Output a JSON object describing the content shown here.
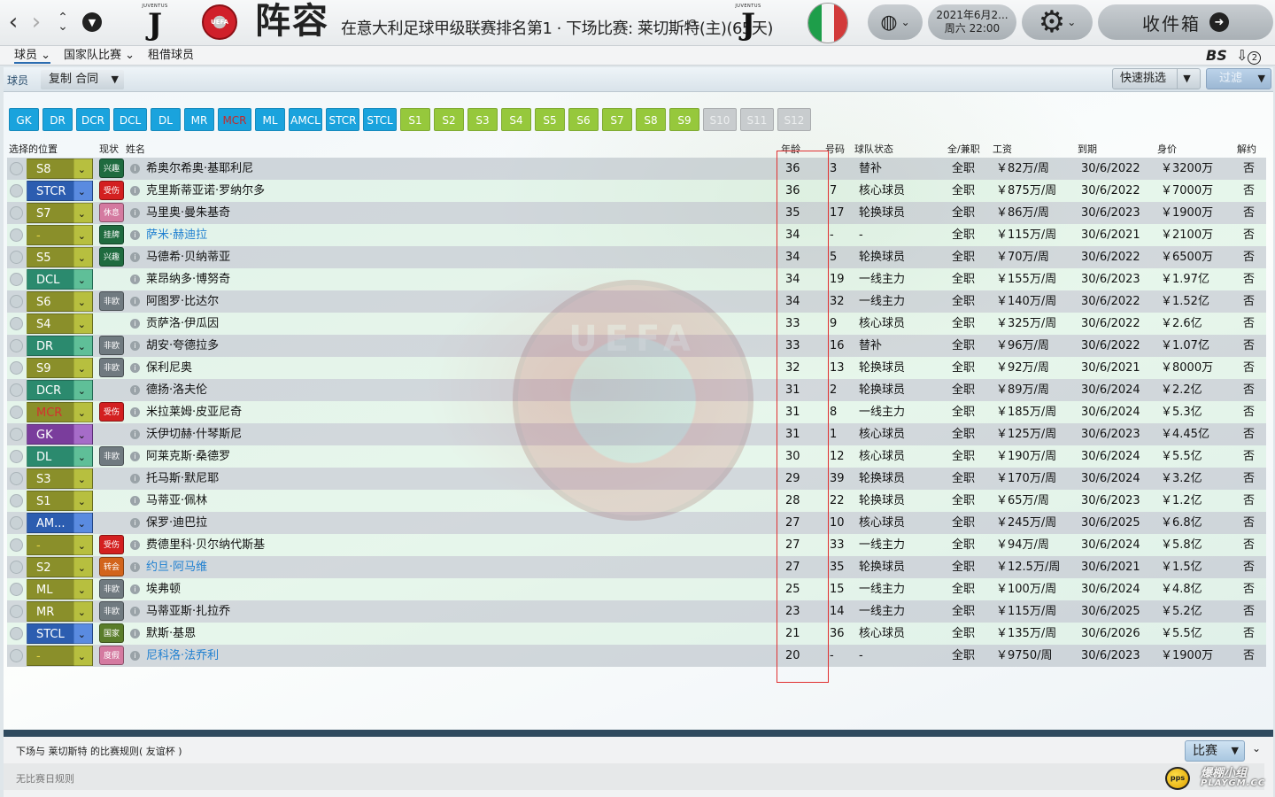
{
  "header": {
    "club_logo_text": "JUVENTUS",
    "club_logo_letter": "J",
    "uefa_text": "UEFA",
    "title": "阵容",
    "subtitle": "在意大利足球甲级联赛排名第1 · 下场比赛: 莱切斯特(主)(65天)",
    "date_line1": "2021年6月2...",
    "date_line2": "周六 22:00",
    "inbox_label": "收件箱",
    "flag_colors": [
      "#1e9e4a",
      "#f4f4f4",
      "#d23a3a"
    ]
  },
  "subtabs": [
    {
      "label": "球员 ⌄"
    },
    {
      "label": "国家队比赛 ⌄"
    },
    {
      "label": "租借球员"
    }
  ],
  "subtab_right": {
    "bs": "BS",
    "notify_count": "2"
  },
  "filter_bar": {
    "label": "球员",
    "select_value": "复制 合同",
    "quick_pick": "快速挑选",
    "filter": "过滤"
  },
  "positions": [
    {
      "label": "GK",
      "style": "blue"
    },
    {
      "label": "DR",
      "style": "blue"
    },
    {
      "label": "DCR",
      "style": "blue"
    },
    {
      "label": "DCL",
      "style": "blue"
    },
    {
      "label": "DL",
      "style": "blue"
    },
    {
      "label": "MR",
      "style": "blue"
    },
    {
      "label": "MCR",
      "style": "red"
    },
    {
      "label": "ML",
      "style": "blue"
    },
    {
      "label": "AMCL",
      "style": "blue"
    },
    {
      "label": "STCR",
      "style": "blue"
    },
    {
      "label": "STCL",
      "style": "blue"
    },
    {
      "label": "S1",
      "style": "green"
    },
    {
      "label": "S2",
      "style": "green"
    },
    {
      "label": "S3",
      "style": "green"
    },
    {
      "label": "S4",
      "style": "green"
    },
    {
      "label": "S5",
      "style": "green"
    },
    {
      "label": "S6",
      "style": "green"
    },
    {
      "label": "S7",
      "style": "green"
    },
    {
      "label": "S8",
      "style": "green"
    },
    {
      "label": "S9",
      "style": "green"
    },
    {
      "label": "S10",
      "style": "grey"
    },
    {
      "label": "S11",
      "style": "grey"
    },
    {
      "label": "S12",
      "style": "grey"
    }
  ],
  "columns": {
    "select_pos": "选择的位置",
    "status": "现状",
    "name": "姓名",
    "age": "年龄",
    "number": "号码",
    "squad_status": "球队状态",
    "ft_pt": "全/兼职",
    "wage": "工资",
    "expires": "到期",
    "value": "身价",
    "release": "解约"
  },
  "players": [
    {
      "pos": "S8",
      "pos_style": "olive",
      "status": "兴趣",
      "status_style": "green",
      "name": "希奥尔希奥·基耶利尼",
      "link": false,
      "age": "36",
      "number": "3",
      "role": "替补",
      "ft": "全职",
      "wage": "￥82万/周",
      "expires": "30/6/2022",
      "value": "￥3200万",
      "release": "否"
    },
    {
      "pos": "STCR",
      "pos_style": "blue",
      "status": "受伤",
      "status_style": "red",
      "name": "克里斯蒂亚诺·罗纳尔多",
      "link": false,
      "age": "36",
      "number": "7",
      "role": "核心球员",
      "ft": "全职",
      "wage": "￥875万/周",
      "expires": "30/6/2022",
      "value": "￥7000万",
      "release": "否"
    },
    {
      "pos": "S7",
      "pos_style": "olive",
      "status": "休息",
      "status_style": "pink",
      "name": "马里奥·曼朱基奇",
      "link": false,
      "age": "35",
      "number": "17",
      "role": "轮换球员",
      "ft": "全职",
      "wage": "￥86万/周",
      "expires": "30/6/2023",
      "value": "￥1900万",
      "release": "否"
    },
    {
      "pos": "-",
      "pos_style": "olive",
      "pos_text": "yel",
      "status": "挂牌",
      "status_style": "green",
      "name": "萨米·赫迪拉",
      "link": true,
      "age": "34",
      "number": "-",
      "role": "-",
      "ft": "全职",
      "wage": "￥115万/周",
      "expires": "30/6/2021",
      "value": "￥2100万",
      "release": "否"
    },
    {
      "pos": "S5",
      "pos_style": "olive",
      "status": "兴趣",
      "status_style": "green",
      "name": "马德希·贝纳蒂亚",
      "link": false,
      "age": "34",
      "number": "5",
      "role": "轮换球员",
      "ft": "全职",
      "wage": "￥70万/周",
      "expires": "30/6/2022",
      "value": "￥6500万",
      "release": "否"
    },
    {
      "pos": "DCL",
      "pos_style": "teal",
      "status": "",
      "status_style": "",
      "name": "莱昂纳多·博努奇",
      "link": false,
      "age": "34",
      "number": "19",
      "role": "一线主力",
      "ft": "全职",
      "wage": "￥155万/周",
      "expires": "30/6/2023",
      "value": "￥1.97亿",
      "release": "否"
    },
    {
      "pos": "S6",
      "pos_style": "olive",
      "status": "非欧",
      "status_style": "grey",
      "name": "阿图罗·比达尔",
      "link": false,
      "age": "34",
      "number": "32",
      "role": "一线主力",
      "ft": "全职",
      "wage": "￥140万/周",
      "expires": "30/6/2022",
      "value": "￥1.52亿",
      "release": "否"
    },
    {
      "pos": "S4",
      "pos_style": "olive",
      "status": "",
      "status_style": "",
      "name": "贡萨洛·伊瓜因",
      "link": false,
      "age": "33",
      "number": "9",
      "role": "核心球员",
      "ft": "全职",
      "wage": "￥325万/周",
      "expires": "30/6/2022",
      "value": "￥2.6亿",
      "release": "否"
    },
    {
      "pos": "DR",
      "pos_style": "teal",
      "status": "非欧",
      "status_style": "grey",
      "name": "胡安·夸德拉多",
      "link": false,
      "age": "33",
      "number": "16",
      "role": "替补",
      "ft": "全职",
      "wage": "￥96万/周",
      "expires": "30/6/2022",
      "value": "￥1.07亿",
      "release": "否"
    },
    {
      "pos": "S9",
      "pos_style": "olive",
      "status": "非欧",
      "status_style": "grey",
      "name": "保利尼奥",
      "link": false,
      "age": "32",
      "number": "13",
      "role": "轮换球员",
      "ft": "全职",
      "wage": "￥92万/周",
      "expires": "30/6/2021",
      "value": "￥8000万",
      "release": "否"
    },
    {
      "pos": "DCR",
      "pos_style": "teal",
      "status": "",
      "status_style": "",
      "name": "德扬·洛夫伦",
      "link": false,
      "age": "31",
      "number": "2",
      "role": "轮换球员",
      "ft": "全职",
      "wage": "￥89万/周",
      "expires": "30/6/2024",
      "value": "￥2.2亿",
      "release": "否"
    },
    {
      "pos": "MCR",
      "pos_style": "olive",
      "pos_text": "red",
      "status": "受伤",
      "status_style": "red",
      "name": "米拉莱姆·皮亚尼奇",
      "link": false,
      "age": "31",
      "number": "8",
      "role": "一线主力",
      "ft": "全职",
      "wage": "￥185万/周",
      "expires": "30/6/2024",
      "value": "￥5.3亿",
      "release": "否"
    },
    {
      "pos": "GK",
      "pos_style": "purple",
      "status": "",
      "status_style": "",
      "name": "沃伊切赫·什琴斯尼",
      "link": false,
      "age": "31",
      "number": "1",
      "role": "核心球员",
      "ft": "全职",
      "wage": "￥125万/周",
      "expires": "30/6/2023",
      "value": "￥4.45亿",
      "release": "否"
    },
    {
      "pos": "DL",
      "pos_style": "teal",
      "status": "非欧",
      "status_style": "grey",
      "name": "阿莱克斯·桑德罗",
      "link": false,
      "age": "30",
      "number": "12",
      "role": "核心球员",
      "ft": "全职",
      "wage": "￥190万/周",
      "expires": "30/6/2024",
      "value": "￥5.5亿",
      "release": "否"
    },
    {
      "pos": "S3",
      "pos_style": "olive",
      "status": "",
      "status_style": "",
      "name": "托马斯·默尼耶",
      "link": false,
      "age": "29",
      "number": "39",
      "role": "轮换球员",
      "ft": "全职",
      "wage": "￥170万/周",
      "expires": "30/6/2024",
      "value": "￥3.2亿",
      "release": "否"
    },
    {
      "pos": "S1",
      "pos_style": "olive",
      "status": "",
      "status_style": "",
      "name": "马蒂亚·佩林",
      "link": false,
      "age": "28",
      "number": "22",
      "role": "轮换球员",
      "ft": "全职",
      "wage": "￥65万/周",
      "expires": "30/6/2023",
      "value": "￥1.2亿",
      "release": "否"
    },
    {
      "pos": "AM...",
      "pos_style": "blue",
      "status": "",
      "status_style": "",
      "name": "保罗·迪巴拉",
      "link": false,
      "age": "27",
      "number": "10",
      "role": "核心球员",
      "ft": "全职",
      "wage": "￥245万/周",
      "expires": "30/6/2025",
      "value": "￥6.8亿",
      "release": "否"
    },
    {
      "pos": "-",
      "pos_style": "olive",
      "pos_text": "yel",
      "status": "受伤",
      "status_style": "red",
      "name": "费德里科·贝尔纳代斯基",
      "link": false,
      "age": "27",
      "number": "33",
      "role": "一线主力",
      "ft": "全职",
      "wage": "￥94万/周",
      "expires": "30/6/2024",
      "value": "￥5.8亿",
      "release": "否"
    },
    {
      "pos": "S2",
      "pos_style": "olive",
      "status": "转会",
      "status_style": "orange",
      "name": "约旦·阿马维",
      "link": true,
      "age": "27",
      "number": "35",
      "role": "轮换球员",
      "ft": "全职",
      "wage": "￥12.5万/周",
      "expires": "30/6/2021",
      "value": "￥1.5亿",
      "release": "否"
    },
    {
      "pos": "ML",
      "pos_style": "olive",
      "status": "非欧",
      "status_style": "grey",
      "name": "埃弗顿",
      "link": false,
      "age": "25",
      "number": "15",
      "role": "一线主力",
      "ft": "全职",
      "wage": "￥100万/周",
      "expires": "30/6/2024",
      "value": "￥4.8亿",
      "release": "否"
    },
    {
      "pos": "MR",
      "pos_style": "olive",
      "status": "非欧",
      "status_style": "grey",
      "name": "马蒂亚斯·扎拉乔",
      "link": false,
      "age": "23",
      "number": "14",
      "role": "一线主力",
      "ft": "全职",
      "wage": "￥115万/周",
      "expires": "30/6/2025",
      "value": "￥5.2亿",
      "release": "否"
    },
    {
      "pos": "STCL",
      "pos_style": "blue",
      "status": "国家",
      "status_style": "olive",
      "name": "默斯·基恩",
      "link": false,
      "age": "21",
      "number": "36",
      "role": "核心球员",
      "ft": "全职",
      "wage": "￥135万/周",
      "expires": "30/6/2026",
      "value": "￥5.5亿",
      "release": "否"
    },
    {
      "pos": "-",
      "pos_style": "olive",
      "pos_text": "yel",
      "status": "度假",
      "status_style": "pink",
      "name": "尼科洛·法乔利",
      "link": true,
      "age": "20",
      "number": "-",
      "role": "-",
      "ft": "全职",
      "wage": "￥9750/周",
      "expires": "30/6/2023",
      "value": "￥1900万",
      "release": "否"
    }
  ],
  "bottom": {
    "rule_title": "下场与 莱切斯特 的比赛规则( 友谊杯 )",
    "rule_body": "无比赛日规则",
    "match_btn": "比赛",
    "watermark_cn": "爆棚小组",
    "watermark_en": "PLAYGM.CC",
    "watermark_ball": "pps"
  }
}
